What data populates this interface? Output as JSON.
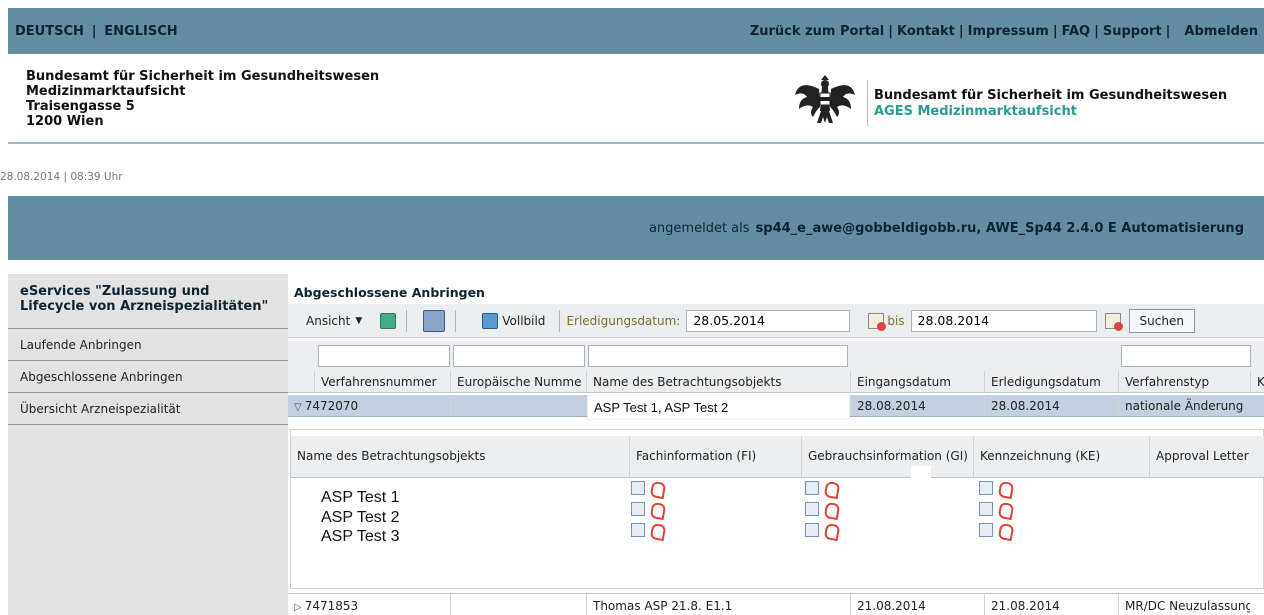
{
  "top_nav": {
    "lang_de": "DEUTSCH",
    "lang_sep": "|",
    "lang_en": "ENGLISCH",
    "links": [
      "Zurück zum Portal",
      "Kontakt",
      "Impressum",
      "FAQ",
      "Support"
    ],
    "logout": "Abmelden"
  },
  "address": {
    "line1": "Bundesamt für Sicherheit im Gesundheitswesen",
    "line2": "Medizinmarktaufsicht",
    "line3": "Traisengasse 5",
    "line4": "1200 Wien"
  },
  "org": {
    "line1": "Bundesamt für Sicherheit im Gesundheitswesen",
    "line2": "AGES Medizinmarktaufsicht"
  },
  "datetime": "28.08.2014 | 08:39 Uhr",
  "userbar": {
    "prefix": "angemeldet als",
    "user": "sp44_e_awe@gobbeldigobb.ru, AWE_Sp44 2.4.0 E Automatisierung"
  },
  "sidebar": {
    "title": "eServices \"Zulassung und Lifecycle von Arzneispezialitäten\"",
    "items": [
      {
        "label": "Laufende Anbringen"
      },
      {
        "label": "Abgeschlossene Anbringen"
      },
      {
        "label": "Übersicht Arzneispezialität"
      }
    ]
  },
  "main": {
    "title": "Abgeschlossene Anbringen",
    "toolbar": {
      "view_label": "Ansicht",
      "fullscreen_label": "Vollbild",
      "date_label": "Erledigungsdatum:",
      "date_from": "28.05.2014",
      "to_label": "bis",
      "date_to": "28.08.2014",
      "search_label": "Suchen"
    },
    "columns": [
      "Verfahrensnummer",
      "Europäische Numme",
      "Name des Betrachtungsobjekts",
      "Eingangsdatum",
      "Erledigungsdatum",
      "Verfahrenstyp",
      "K"
    ],
    "rows": [
      {
        "nr": "7472070",
        "eu": "",
        "name": "ASP Test 1, ASP Test 2",
        "eingang": "28.08.2014",
        "erledigung": "28.08.2014",
        "typ": "nationale Änderung"
      },
      {
        "nr": "7471853",
        "eu": "",
        "name": "Thomas ASP 21.8. E1.1",
        "eingang": "21.08.2014",
        "erledigung": "21.08.2014",
        "typ": "MR/DC Neuzulassung"
      }
    ],
    "detail": {
      "columns": [
        "Name des Betrachtungsobjekts",
        "Fachinformation (FI)",
        "Gebrauchsinformation (GI)",
        "Kennzeichnung (KE)",
        "Approval Letter"
      ],
      "items": [
        "ASP Test 1",
        "ASP Test 2",
        "ASP Test 3"
      ]
    }
  }
}
